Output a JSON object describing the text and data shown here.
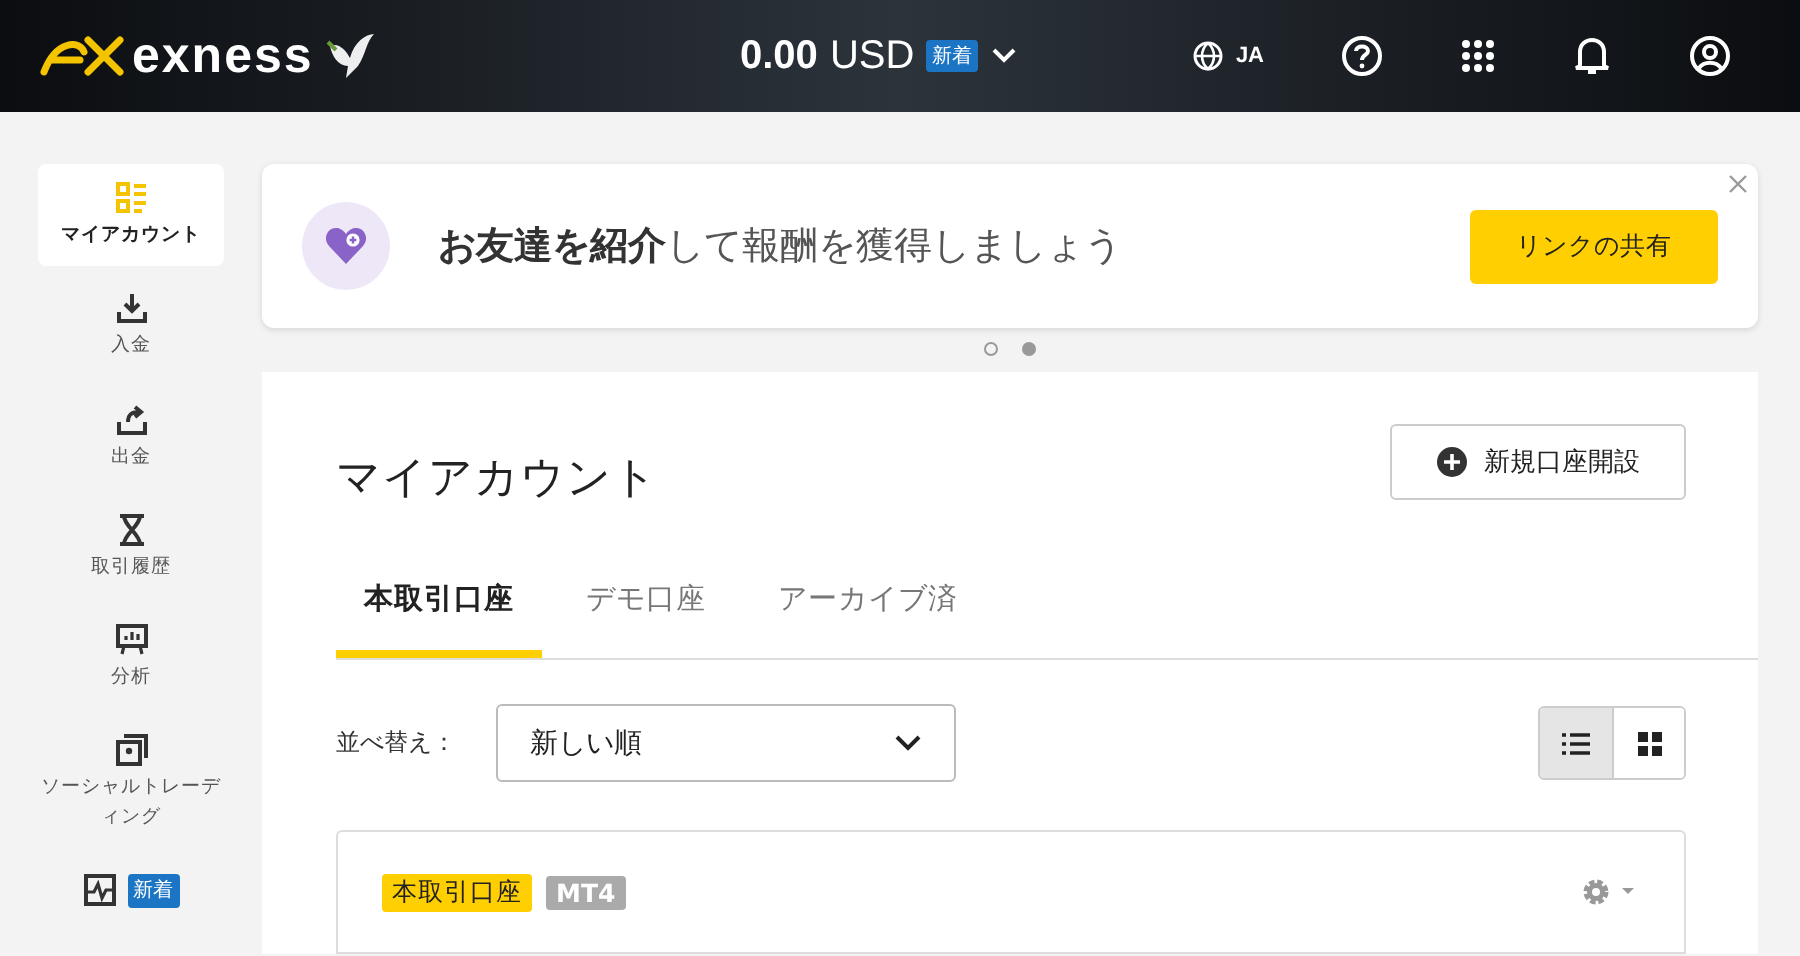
{
  "header": {
    "logo": "exness",
    "balance": "0.00",
    "currency": "USD",
    "badge": "新着",
    "language": "JA"
  },
  "sidebar": {
    "items": [
      {
        "label": "マイアカウント",
        "selected": true
      },
      {
        "label": "入金",
        "selected": false
      },
      {
        "label": "出金",
        "selected": false
      },
      {
        "label": "取引履歴",
        "selected": false
      },
      {
        "label": "分析",
        "selected": false
      },
      {
        "label": "ソーシャルトレーディング",
        "selected": false
      },
      {
        "badge": "新着",
        "selected": false
      }
    ]
  },
  "banner": {
    "text": "**お友達を紹介**して報酬を獲得しましょう",
    "button": "リンクの共有",
    "dots": [
      {
        "selected": false
      },
      {
        "selected": true
      }
    ]
  },
  "accounts": {
    "title": "マイアカウント",
    "new_button": "新規口座開設",
    "tabs": [
      {
        "label": "本取引口座",
        "selected": true
      },
      {
        "label": "デモ口座",
        "selected": false
      },
      {
        "label": "アーカイブ済",
        "selected": false
      }
    ],
    "sort_label": "並べ替え：",
    "sort_value": "新しい順",
    "views": [
      {
        "kind": "list",
        "selected": true
      },
      {
        "kind": "grid",
        "selected": false
      }
    ],
    "card": {
      "type_tag": "本取引口座",
      "platform_tag": "MT4"
    }
  }
}
